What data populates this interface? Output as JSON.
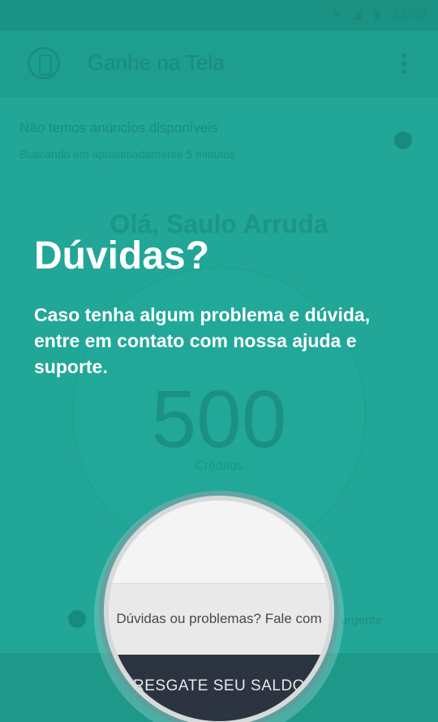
{
  "status_bar": {
    "time": "12:30"
  },
  "app_bar": {
    "title": "Ganhe na Tela"
  },
  "ad_banner": {
    "title": "Não temos anúncios disponíveis",
    "subtitle": "Buscando em aproximadamente 5 minutos"
  },
  "greeting": "Olá, Saulo Arruda",
  "credits": {
    "value": "500",
    "label": "Créditos"
  },
  "help_row": {
    "tail_text": "urgente"
  },
  "tutorial": {
    "title": "Dúvidas?",
    "body": "Caso tenha algum problema e dúvida, entre em contato com nossa ajuda e suporte.",
    "spotlight_text": "Dúvidas ou problemas? Fale com",
    "spotlight_button": "RESGATE SEU SALDO"
  },
  "colors": {
    "primary": "#20a596",
    "overlay_text": "#ffffff",
    "button_dark": "#2b3440"
  }
}
